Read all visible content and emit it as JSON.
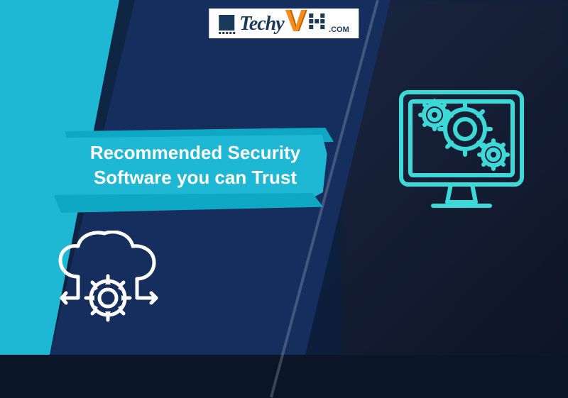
{
  "logo": {
    "text_prefix": "Techy",
    "text_v": "V",
    "text_suffix": ".COM"
  },
  "banner": {
    "title_line1": "Recommended Security",
    "title_line2": "Software you can Trust"
  },
  "icons": {
    "cloud_gear": "cloud-gear-icon",
    "monitor_gears": "monitor-gears-icon"
  },
  "colors": {
    "primary_cyan": "#1fb8d4",
    "dark_navy": "#152e5e",
    "teal_icon": "#2dd4d4",
    "white": "#ffffff",
    "logo_orange": "#f28c1a"
  }
}
